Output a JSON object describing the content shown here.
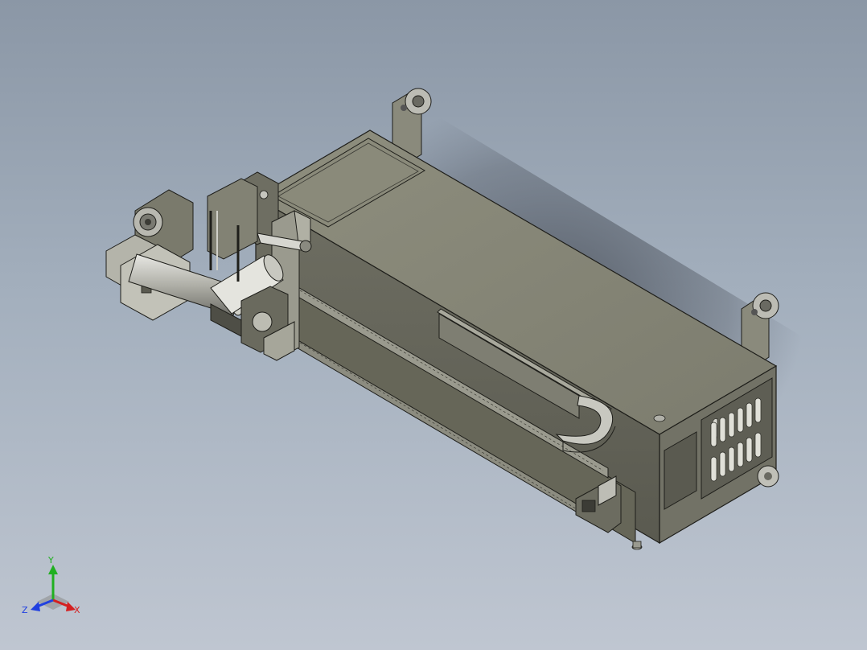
{
  "viewport": {
    "background_top": "#8b97a6",
    "background_bottom": "#bfc6d1"
  },
  "model": {
    "body_color": "#7a7a6c",
    "top_color": "#888877",
    "side_color": "#6a6a5e",
    "edge_color": "#1e1e1a",
    "metal_color": "#c8c8c4"
  },
  "triad": {
    "x_label": "X",
    "y_label": "Y",
    "z_label": "Z",
    "x_color": "#d42020",
    "y_color": "#20b020",
    "z_color": "#2040e0"
  }
}
